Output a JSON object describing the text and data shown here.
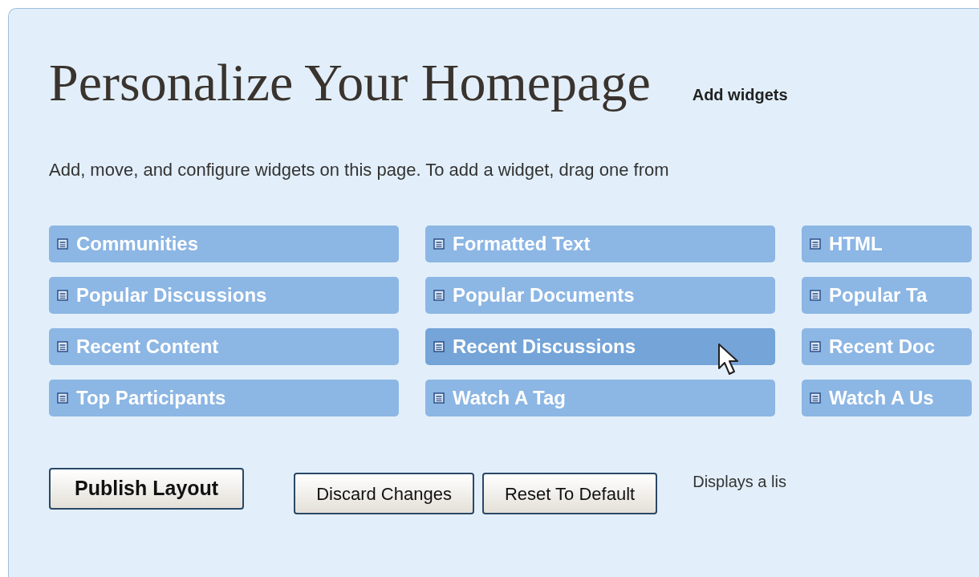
{
  "title": "Personalize Your Homepage",
  "title_hint": "Add widgets",
  "instructions": "Add, move, and configure widgets on this page. To add a widget, drag one from",
  "widgets": [
    {
      "label": "Communities",
      "hovered": false
    },
    {
      "label": "Formatted Text",
      "hovered": false
    },
    {
      "label": "HTML",
      "hovered": false
    },
    {
      "label": "Popular Discussions",
      "hovered": false
    },
    {
      "label": "Popular Documents",
      "hovered": false
    },
    {
      "label": "Popular Ta",
      "hovered": false
    },
    {
      "label": "Recent Content",
      "hovered": false
    },
    {
      "label": "Recent Discussions",
      "hovered": true
    },
    {
      "label": "Recent Doc",
      "hovered": false
    },
    {
      "label": "Top Participants",
      "hovered": false
    },
    {
      "label": "Watch A Tag",
      "hovered": false
    },
    {
      "label": "Watch A Us",
      "hovered": false
    }
  ],
  "buttons": [
    {
      "label": "Publish Layout",
      "kind": "primary"
    },
    {
      "label": "Discard Changes",
      "kind": "secondary"
    },
    {
      "label": "Reset To Default",
      "kind": "secondary"
    }
  ],
  "description": "Displays a lis"
}
